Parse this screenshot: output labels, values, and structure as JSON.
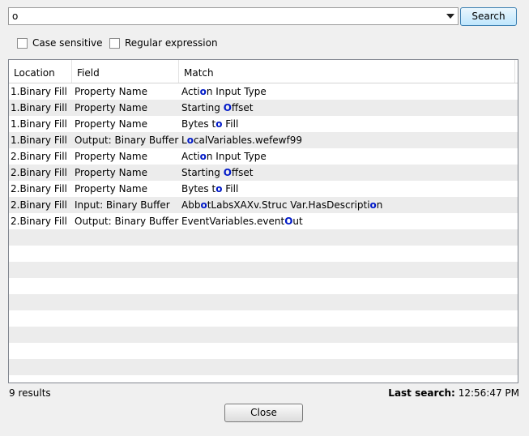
{
  "search": {
    "query": "o",
    "button_label": "Search"
  },
  "options": {
    "case_sensitive_label": "Case sensitive",
    "case_sensitive_checked": false,
    "regex_label": "Regular expression",
    "regex_checked": false
  },
  "table": {
    "columns": [
      "Location",
      "Field",
      "Match"
    ],
    "rows": [
      {
        "location": "1.Binary Fill",
        "field": "Property Name",
        "match": [
          [
            "Acti",
            ""
          ],
          [
            "o",
            "hl"
          ],
          [
            "n Input Type",
            ""
          ]
        ]
      },
      {
        "location": "1.Binary Fill",
        "field": "Property Name",
        "match": [
          [
            "Starting ",
            ""
          ],
          [
            "O",
            "hl"
          ],
          [
            "ffset",
            ""
          ]
        ]
      },
      {
        "location": "1.Binary Fill",
        "field": "Property Name",
        "match": [
          [
            "Bytes t",
            ""
          ],
          [
            "o",
            "hl"
          ],
          [
            " Fill",
            ""
          ]
        ]
      },
      {
        "location": "1.Binary Fill",
        "field": "Output: Binary Buffer",
        "match": [
          [
            "L",
            ""
          ],
          [
            "o",
            "hl"
          ],
          [
            "calVariables.wefewf99",
            ""
          ]
        ]
      },
      {
        "location": "2.Binary Fill",
        "field": "Property Name",
        "match": [
          [
            "Acti",
            ""
          ],
          [
            "o",
            "hl"
          ],
          [
            "n Input Type",
            ""
          ]
        ]
      },
      {
        "location": "2.Binary Fill",
        "field": "Property Name",
        "match": [
          [
            "Starting ",
            ""
          ],
          [
            "O",
            "hl"
          ],
          [
            "ffset",
            ""
          ]
        ]
      },
      {
        "location": "2.Binary Fill",
        "field": "Property Name",
        "match": [
          [
            "Bytes t",
            ""
          ],
          [
            "o",
            "hl"
          ],
          [
            " Fill",
            ""
          ]
        ]
      },
      {
        "location": "2.Binary Fill",
        "field": "Input: Binary Buffer",
        "match": [
          [
            "Abb",
            ""
          ],
          [
            "o",
            "hl"
          ],
          [
            "tLabsXAXv.Struc Var.HasDescripti",
            ""
          ],
          [
            "o",
            "hl"
          ],
          [
            "n",
            ""
          ]
        ]
      },
      {
        "location": "2.Binary Fill",
        "field": "Output: Binary Buffer",
        "match": [
          [
            "EventVariables.event",
            ""
          ],
          [
            "O",
            "hl"
          ],
          [
            "ut",
            ""
          ]
        ]
      }
    ],
    "empty_rows": 9
  },
  "status": {
    "results": "9 results",
    "last_search_label": "Last search:",
    "last_search_time": "12:56:47 PM"
  },
  "close_label": "Close",
  "colors": {
    "highlight": "#0019c8",
    "alt_row": "#ececec"
  }
}
